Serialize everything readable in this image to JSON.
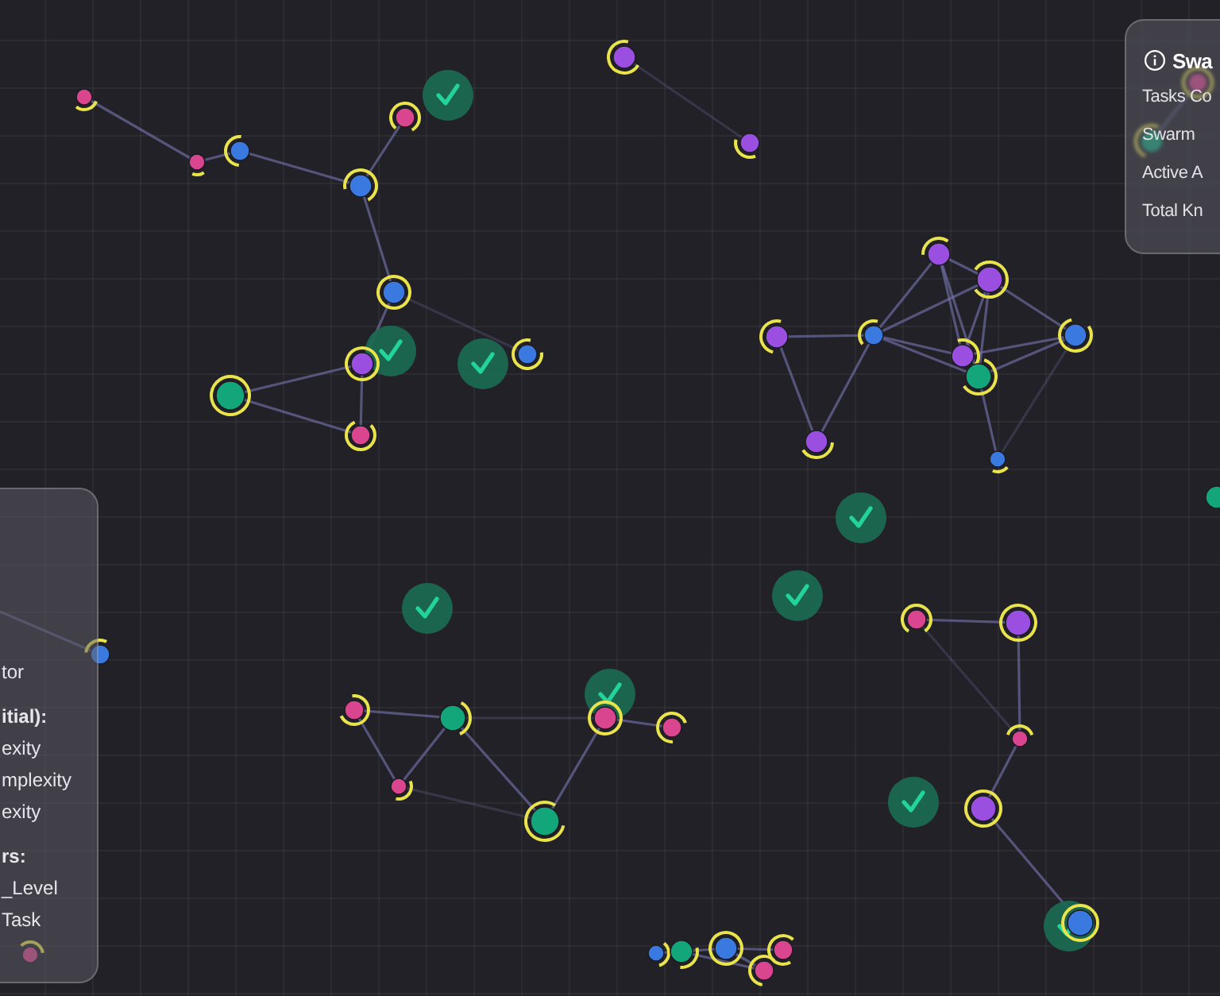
{
  "stats_panel": {
    "title": "Swa",
    "rows": [
      "Tasks Co",
      "Swarm",
      "Active A",
      "Total Kn"
    ]
  },
  "legend_panel": {
    "items": [
      {
        "text": "tor",
        "kind": "plain"
      },
      {
        "text": "itial):",
        "kind": "heading"
      },
      {
        "text": "exity",
        "kind": "plain"
      },
      {
        "text": "mplexity",
        "kind": "plain"
      },
      {
        "text": "exity",
        "kind": "plain"
      },
      {
        "text": "rs:",
        "kind": "heading"
      },
      {
        "text": "_Level",
        "kind": "plain"
      },
      {
        "text": "Task",
        "kind": "plain"
      }
    ]
  }
}
